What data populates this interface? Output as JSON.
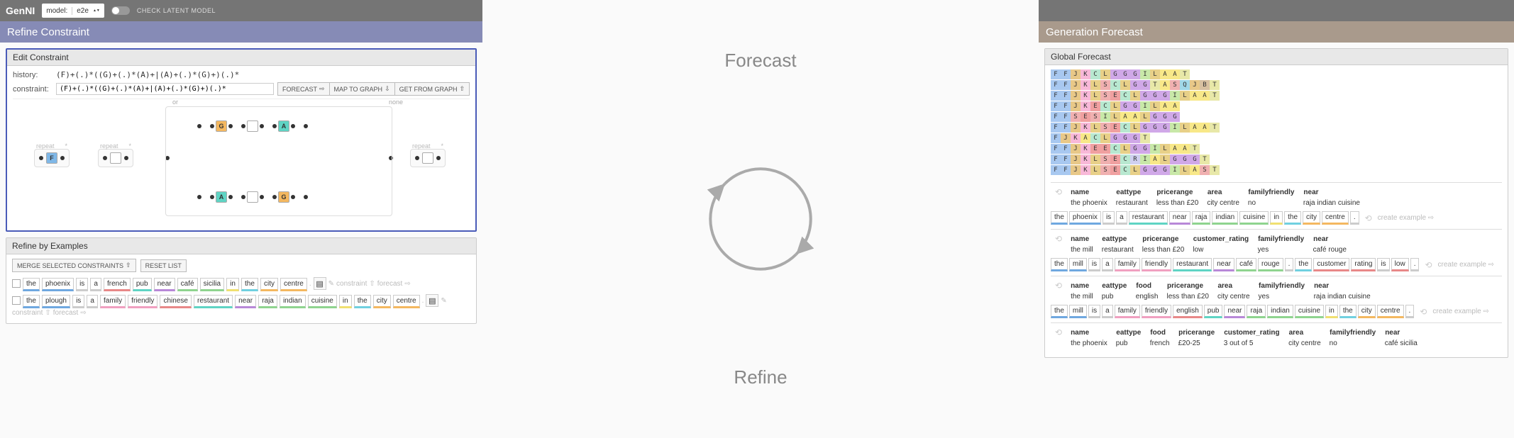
{
  "app": {
    "title": "GenNI",
    "model_label": "model:",
    "model_value": "e2e",
    "toggle_label": "CHECK LATENT MODEL"
  },
  "left": {
    "section_title": "Refine Constraint",
    "edit": {
      "title": "Edit Constraint",
      "history_label": "history:",
      "history_value": "(F)+(.)*((G)+(.)*(A)+|(A)+(.)*(G)+)(.)*",
      "constraint_label": "constraint:",
      "constraint_value": "(F)+(.)*((G)+(.)*(A)+|(A)+(.)*(G)+)(.)*",
      "btn_forecast": "FORECAST",
      "btn_map": "MAP TO GRAPH",
      "btn_get": "GET FROM GRAPH",
      "or_label": "or",
      "none_label": "none",
      "repeat_label": "repeat",
      "star": "*"
    },
    "refine": {
      "title": "Refine by Examples",
      "merge": "MERGE SELECTED CONSTRAINTS",
      "reset": "RESET LIST",
      "constraint_link": "constraint",
      "forecast_link": "forecast",
      "ex1": [
        "the",
        "phoenix",
        "is",
        "a",
        "french",
        "pub",
        "near",
        "café",
        "sicilia",
        "in",
        "the",
        "city",
        "centre"
      ],
      "ex1_colors": [
        "blue",
        "blue",
        "gray",
        "gray",
        "red",
        "teal",
        "purple",
        "green",
        "green",
        "yellow",
        "cyan",
        "orange",
        "orange"
      ],
      "ex2": [
        "the",
        "plough",
        "is",
        "a",
        "family",
        "friendly",
        "chinese",
        "restaurant",
        "near",
        "raja",
        "indian",
        "cuisine",
        "in",
        "the",
        "city",
        "centre"
      ],
      "ex2_colors": [
        "blue",
        "blue",
        "gray",
        "gray",
        "pink",
        "pink",
        "red",
        "teal",
        "purple",
        "green",
        "green",
        "green",
        "yellow",
        "cyan",
        "orange",
        "orange"
      ]
    }
  },
  "cycle": {
    "forecast": "Forecast",
    "refine": "Refine"
  },
  "right": {
    "section_title": "Generation Forecast",
    "global_title": "Global Forecast",
    "letter_rows": [
      "FFJKCLGGGILAAT",
      "FFJKLSCLGGTASQJBT",
      "FFJKLSECLGGGILAAT",
      "FFJKECLGGILAA",
      "FFSESILAALGGG",
      "FFJKLSECLGGGILAAT",
      "FJKACLGGGT",
      "FFJKEECLGGILAAT",
      "FFJKLSECRIALGGGT",
      "FFJKLSECLGGGILAST"
    ],
    "create_example": "create example",
    "examples": [
      {
        "headers": [
          "name",
          "eattype",
          "pricerange",
          "area",
          "familyfriendly",
          "near"
        ],
        "values": [
          "the phoenix",
          "restaurant",
          "less than £20",
          "city centre",
          "no",
          "raja indian cuisine"
        ],
        "tokens": [
          "the",
          "phoenix",
          "is",
          "a",
          "restaurant",
          "near",
          "raja",
          "indian",
          "cuisine",
          "in",
          "the",
          "city",
          "centre",
          "."
        ],
        "tok_colors": [
          "blue",
          "blue",
          "gray",
          "gray",
          "teal",
          "purple",
          "green",
          "green",
          "green",
          "yellow",
          "cyan",
          "orange",
          "orange",
          "gray"
        ]
      },
      {
        "headers": [
          "name",
          "eattype",
          "pricerange",
          "customer_rating",
          "familyfriendly",
          "near"
        ],
        "values": [
          "the mill",
          "restaurant",
          "less than £20",
          "low",
          "yes",
          "café rouge"
        ],
        "tokens": [
          "the",
          "mill",
          "is",
          "a",
          "family",
          "friendly",
          "restaurant",
          "near",
          "café",
          "rouge",
          ".",
          "the",
          "customer",
          "rating",
          "is",
          "low",
          "."
        ],
        "tok_colors": [
          "blue",
          "blue",
          "gray",
          "gray",
          "pink",
          "pink",
          "teal",
          "purple",
          "green",
          "green",
          "gray",
          "cyan",
          "red",
          "red",
          "gray",
          "red",
          "gray"
        ]
      },
      {
        "headers": [
          "name",
          "eattype",
          "food",
          "pricerange",
          "area",
          "familyfriendly",
          "near"
        ],
        "values": [
          "the mill",
          "pub",
          "english",
          "less than £20",
          "city centre",
          "yes",
          "raja indian cuisine"
        ],
        "tokens": [
          "the",
          "mill",
          "is",
          "a",
          "family",
          "friendly",
          "english",
          "pub",
          "near",
          "raja",
          "indian",
          "cuisine",
          "in",
          "the",
          "city",
          "centre",
          "."
        ],
        "tok_colors": [
          "blue",
          "blue",
          "gray",
          "gray",
          "pink",
          "pink",
          "red",
          "teal",
          "purple",
          "green",
          "green",
          "green",
          "yellow",
          "cyan",
          "orange",
          "orange",
          "gray"
        ]
      },
      {
        "headers": [
          "name",
          "eattype",
          "food",
          "pricerange",
          "customer_rating",
          "area",
          "familyfriendly",
          "near"
        ],
        "values": [
          "the phoenix",
          "pub",
          "french",
          "£20-25",
          "3 out of 5",
          "city centre",
          "no",
          "café sicilia"
        ],
        "tokens": [],
        "tok_colors": []
      }
    ]
  }
}
